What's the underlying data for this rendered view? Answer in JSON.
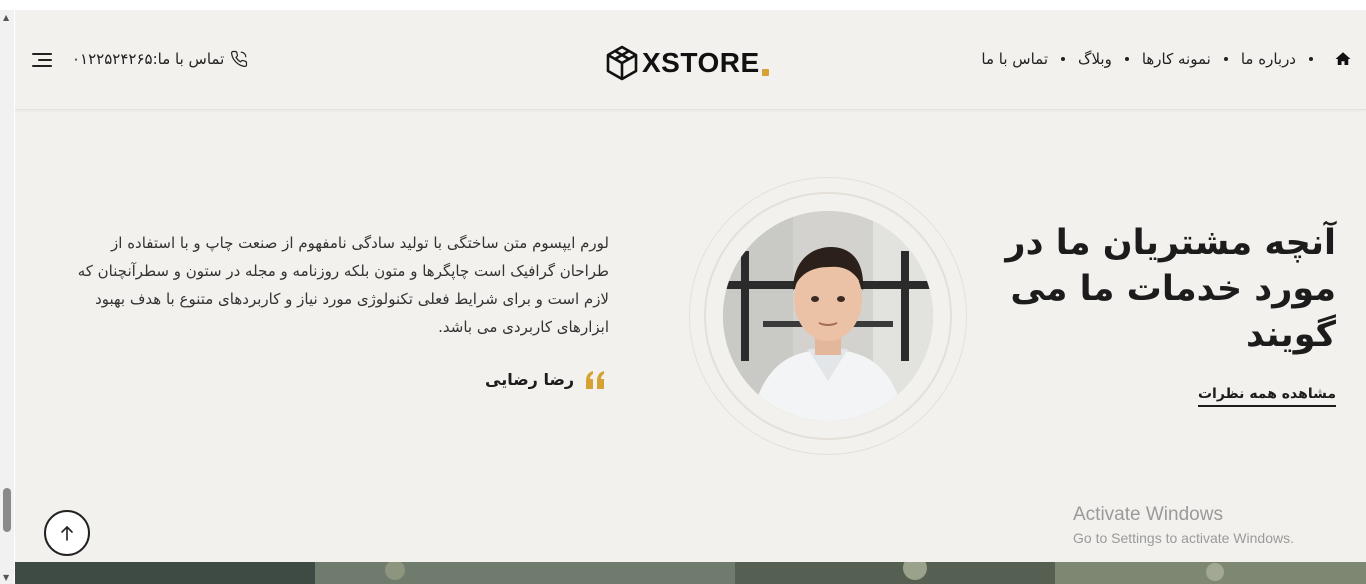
{
  "header": {
    "nav": {
      "items": [
        "درباره ما",
        "نمونه کارها",
        "وبلاگ",
        "تماس با ما"
      ]
    },
    "logo": {
      "text": "XSTORE"
    },
    "contact": {
      "label": "تماس با ما:",
      "phone": "۰۱۲۲۵۲۴۲۶۵"
    },
    "icons": {
      "home": "home-icon",
      "phone": "phone-icon",
      "menu": "hamburger-menu-icon"
    }
  },
  "testimonial": {
    "headline": "آنچه مشتریان ما در مورد خدمات ما می گویند",
    "view_all": "مشاهده همه نظرات",
    "quote": "لورم ایپسوم متن ساختگی با تولید سادگی نامفهوم از صنعت چاپ و با استفاده از طراحان گرافیک است چاپگرها و متون بلکه روزنامه و مجله در ستون و سطرآنچنان که لازم است و برای شرایط فعلی تکنولوژی مورد نیاز و کاربردهای متنوع با هدف بهبود ابزارهای کاربردی می باشد.",
    "author": "رضا رضایی"
  },
  "windows_watermark": {
    "title": "Activate Windows",
    "subtitle": "Go to Settings to activate Windows."
  },
  "colors": {
    "background": "#f3f1ed",
    "accent": "#d6a234",
    "text": "#1c1c1c"
  }
}
